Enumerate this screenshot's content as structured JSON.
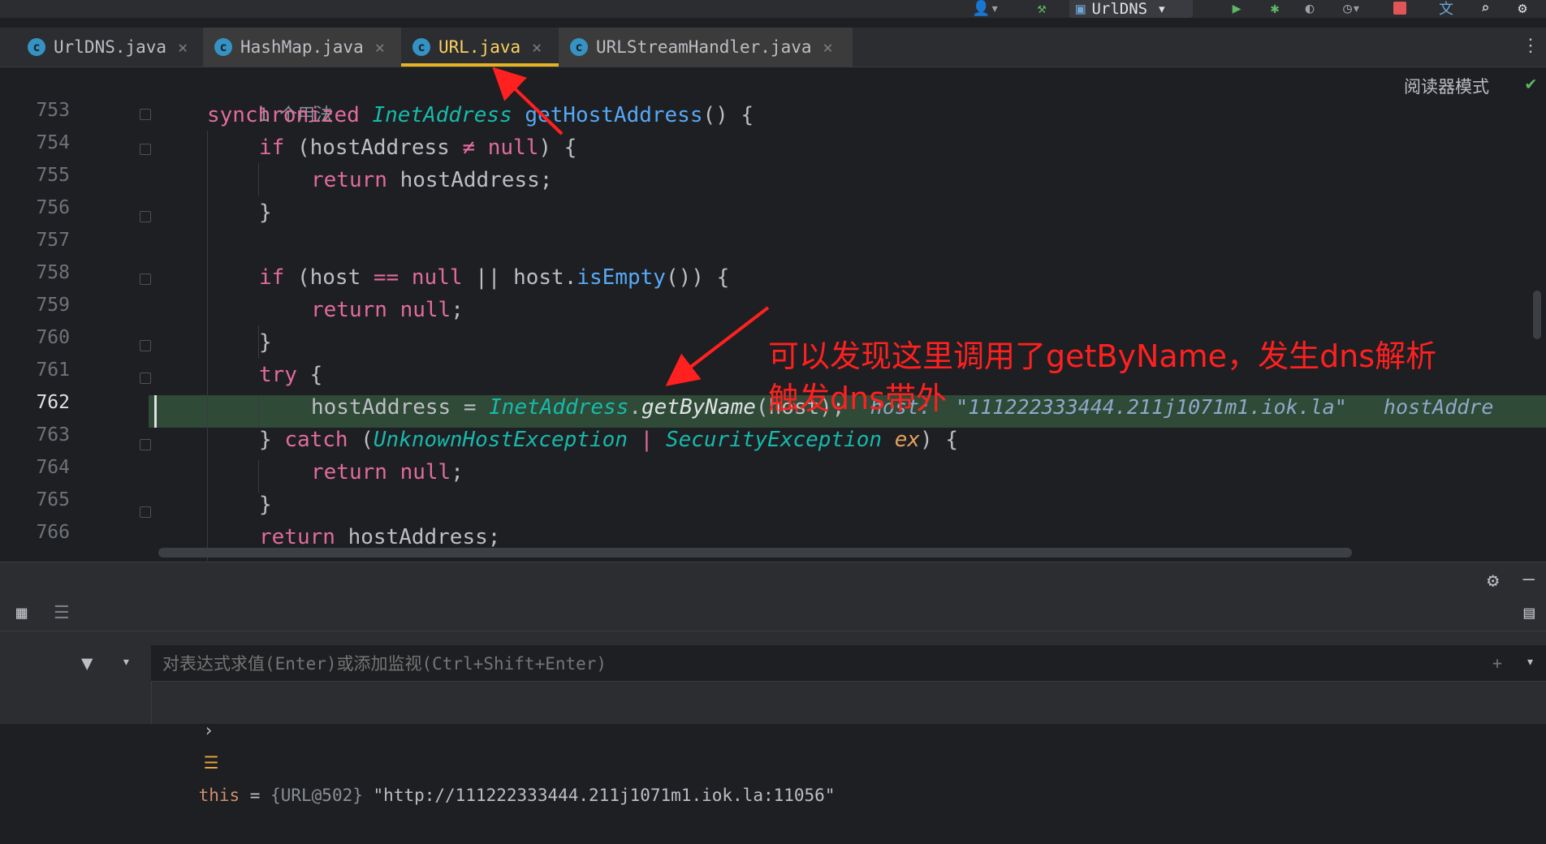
{
  "toolbar": {
    "run_config": "UrlDNS",
    "colors": {
      "run": "#5fb865",
      "stop": "#e05555"
    }
  },
  "tabs": [
    {
      "label": "UrlDNS.java"
    },
    {
      "label": "HashMap.java"
    },
    {
      "label": "URL.java",
      "active": true
    },
    {
      "label": "URLStreamHandler.java"
    }
  ],
  "editor": {
    "usage_hint": "1 个用法",
    "reader_mode": "阅读器模式",
    "line_numbers": [
      "753",
      "754",
      "755",
      "756",
      "757",
      "758",
      "759",
      "760",
      "761",
      "762",
      "763",
      "764",
      "765",
      "766"
    ],
    "current_line": "762",
    "code": {
      "l753": {
        "kw": "synchronized",
        "type": "InetAddress",
        "method": "getHostAddress",
        "rest": "() {"
      },
      "l754": {
        "kw": "if",
        "a": "(hostAddress ",
        "op": "≠",
        "b": " ",
        "null": "null",
        "c": ") {"
      },
      "l755": {
        "kw": "return",
        "rest": " hostAddress;"
      },
      "l756": "}",
      "l758": {
        "kw": "if",
        "a": "(host ",
        "op": "==",
        "null": "null",
        "b": " || host.",
        "method": "isEmpty",
        "c": "()) {"
      },
      "l759": {
        "kw": "return",
        "null": "null",
        "c": ";"
      },
      "l760": "}",
      "l761": {
        "kw": "try",
        "rest": " {"
      },
      "l762": {
        "a": "hostAddress = ",
        "type": "InetAddress",
        "dot": ".",
        "method": "getByName",
        "rest": "(host);",
        "inline": "host:  \"111222333444.211j1071m1.iok.la\"   hostAddre"
      },
      "l763": {
        "a": "} ",
        "kw": "catch",
        "b": " (",
        "t1": "UnknownHostException",
        "bar": " | ",
        "t2": "SecurityException",
        "ex": " ex",
        "c": ") {"
      },
      "l764": {
        "kw": "return",
        "null": "null",
        "c": ";"
      },
      "l765": "}",
      "l766": {
        "kw": "return",
        "rest": " hostAddress;"
      }
    },
    "annotation": [
      "可以发现这里调用了getByName，发生dns解析",
      "触发dns带外"
    ]
  },
  "debug": {
    "eval_placeholder": "对表达式求值(Enter)或添加监视(Ctrl+Shift+Enter)",
    "variable": {
      "name": "this",
      "eq": " = ",
      "type": "{URL@502}",
      "value": " \"http://111222333444.211j1071m1.iok.la:11056\""
    }
  }
}
